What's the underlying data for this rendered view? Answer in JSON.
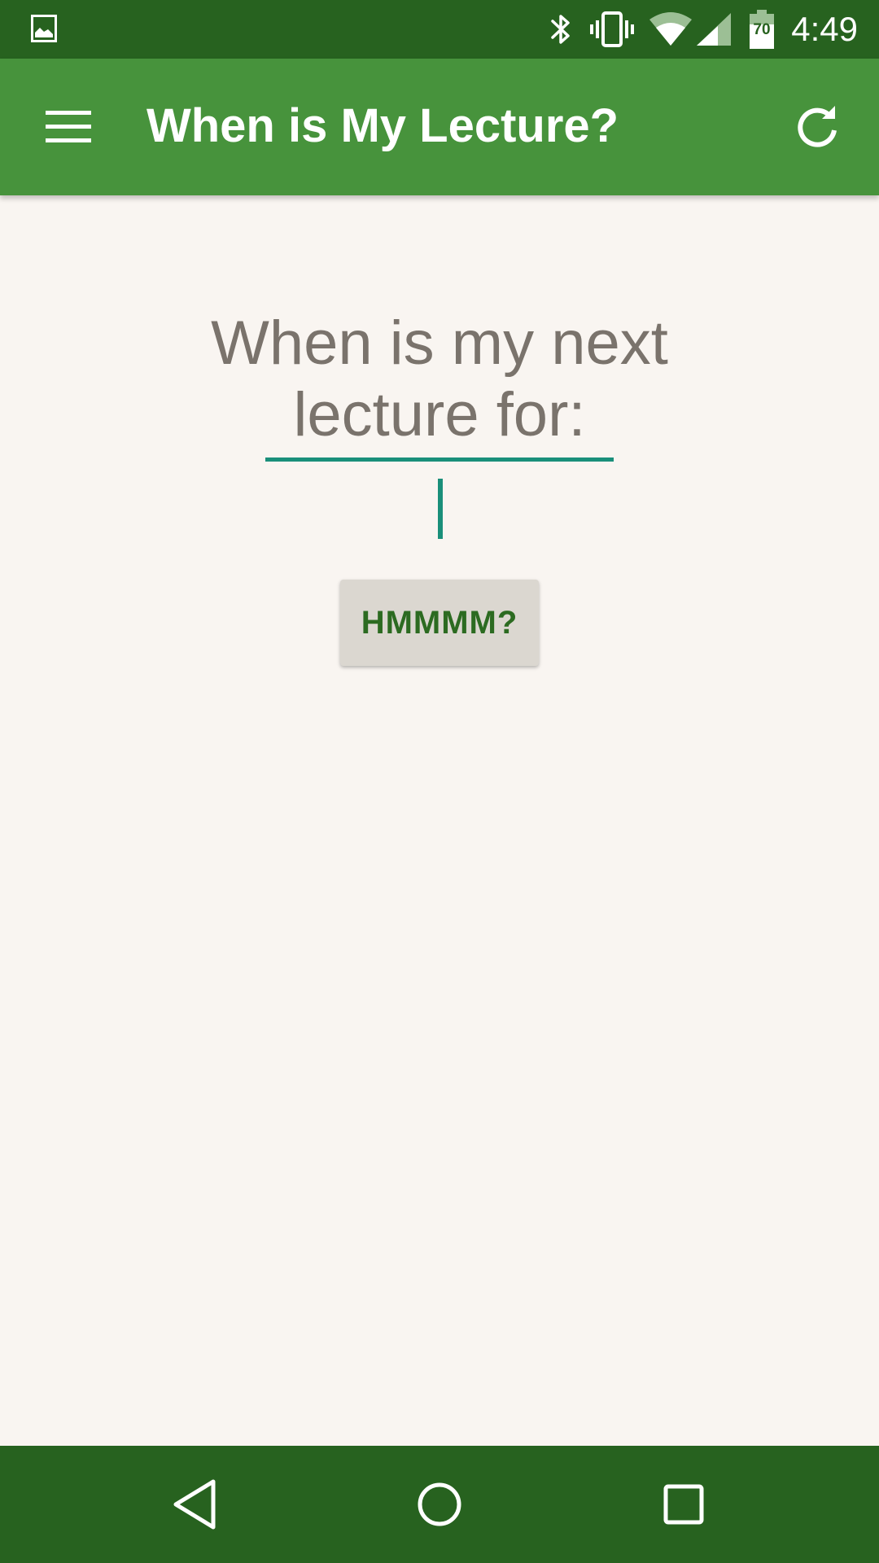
{
  "status_bar": {
    "time": "4:49",
    "battery_level": "70",
    "icons": [
      "image-notification-icon",
      "bluetooth-icon",
      "vibrate-icon",
      "wifi-icon",
      "cellular-signal-icon",
      "battery-icon"
    ]
  },
  "app_bar": {
    "title": "When is My Lecture?",
    "menu_icon": "hamburger-menu-icon",
    "refresh_icon": "refresh-icon"
  },
  "main": {
    "prompt_line1": "When is my next",
    "prompt_line2": "lecture for:",
    "course_input": {
      "value": "",
      "placeholder": ""
    },
    "submit_label": "HMMMM?"
  },
  "nav_bar": {
    "icons": [
      "back-icon",
      "home-icon",
      "recents-icon"
    ]
  },
  "colors": {
    "status_bar": "#27621f",
    "app_bar": "#47933c",
    "background": "#f9f5f1",
    "accent": "#1a8f7a",
    "prompt_text": "#7a736c",
    "button_bg": "#dbd7d0",
    "button_text": "#2c6b21"
  }
}
